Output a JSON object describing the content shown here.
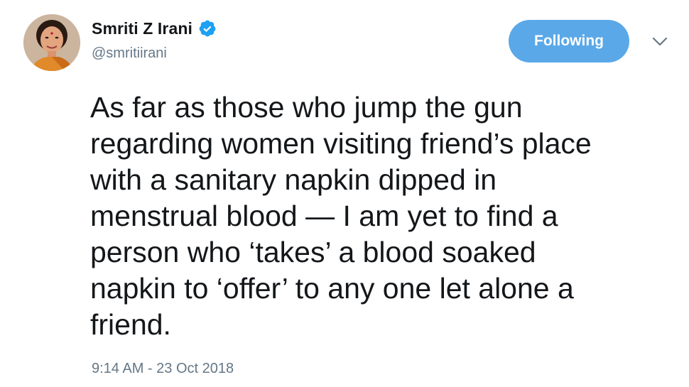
{
  "author": {
    "display_name": "Smriti Z Irani",
    "handle": "@smritiirani",
    "verified": true,
    "avatar_icon": "profile-photo"
  },
  "actions": {
    "follow_label": "Following",
    "follow_color": "#5aa8e8",
    "more_icon": "chevron-down-icon"
  },
  "tweet": {
    "text": "As far as those who jump the gun\nregarding women visiting friend’s place\nwith a sanitary napkin dipped in\nmenstrual blood — I am yet to find a\nperson who ‘takes’ a blood soaked\nnapkin to ‘offer’ to any one let alone a\nfriend.",
    "timestamp": "9:14 AM - 23 Oct 2018"
  },
  "colors": {
    "text": "#14171a",
    "secondary": "#657786",
    "verified": "#1da1f2"
  }
}
